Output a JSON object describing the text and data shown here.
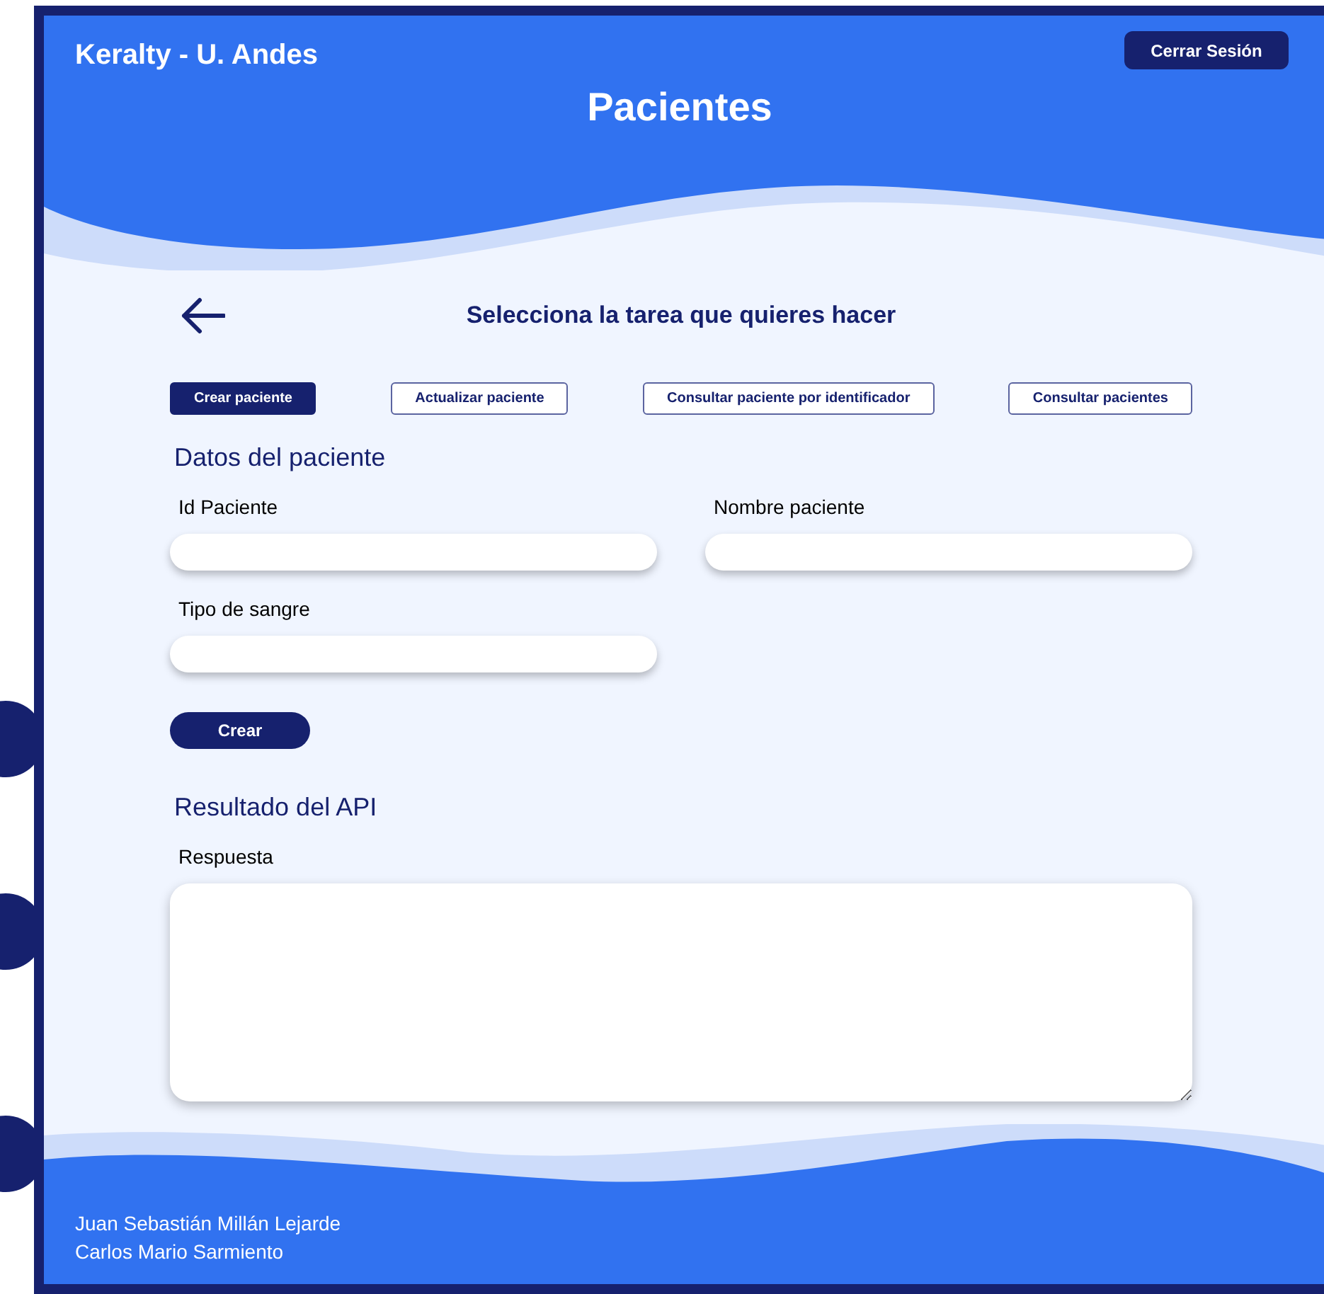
{
  "header": {
    "brand": "Keralty - U. Andes",
    "logout_button": "Cerrar Sesión",
    "title": "Pacientes"
  },
  "task_heading": "Selecciona la tarea que quieres hacer",
  "tabs": [
    {
      "label": "Crear paciente",
      "selected": true
    },
    {
      "label": "Actualizar paciente",
      "selected": false
    },
    {
      "label": "Consultar paciente por identificador",
      "selected": false
    },
    {
      "label": "Consultar pacientes",
      "selected": false
    }
  ],
  "form": {
    "title": "Datos del paciente",
    "fields": [
      {
        "label": "Id Paciente"
      },
      {
        "label": "Nombre paciente"
      },
      {
        "label": "Tipo de sangre"
      }
    ],
    "submit_button": "Crear"
  },
  "result": {
    "title": "Resultado del API",
    "label": "Respuesta"
  },
  "footer": {
    "authors": [
      "Juan Sebastián Millán Lejarde",
      "Carlos Mario Sarmiento"
    ]
  }
}
